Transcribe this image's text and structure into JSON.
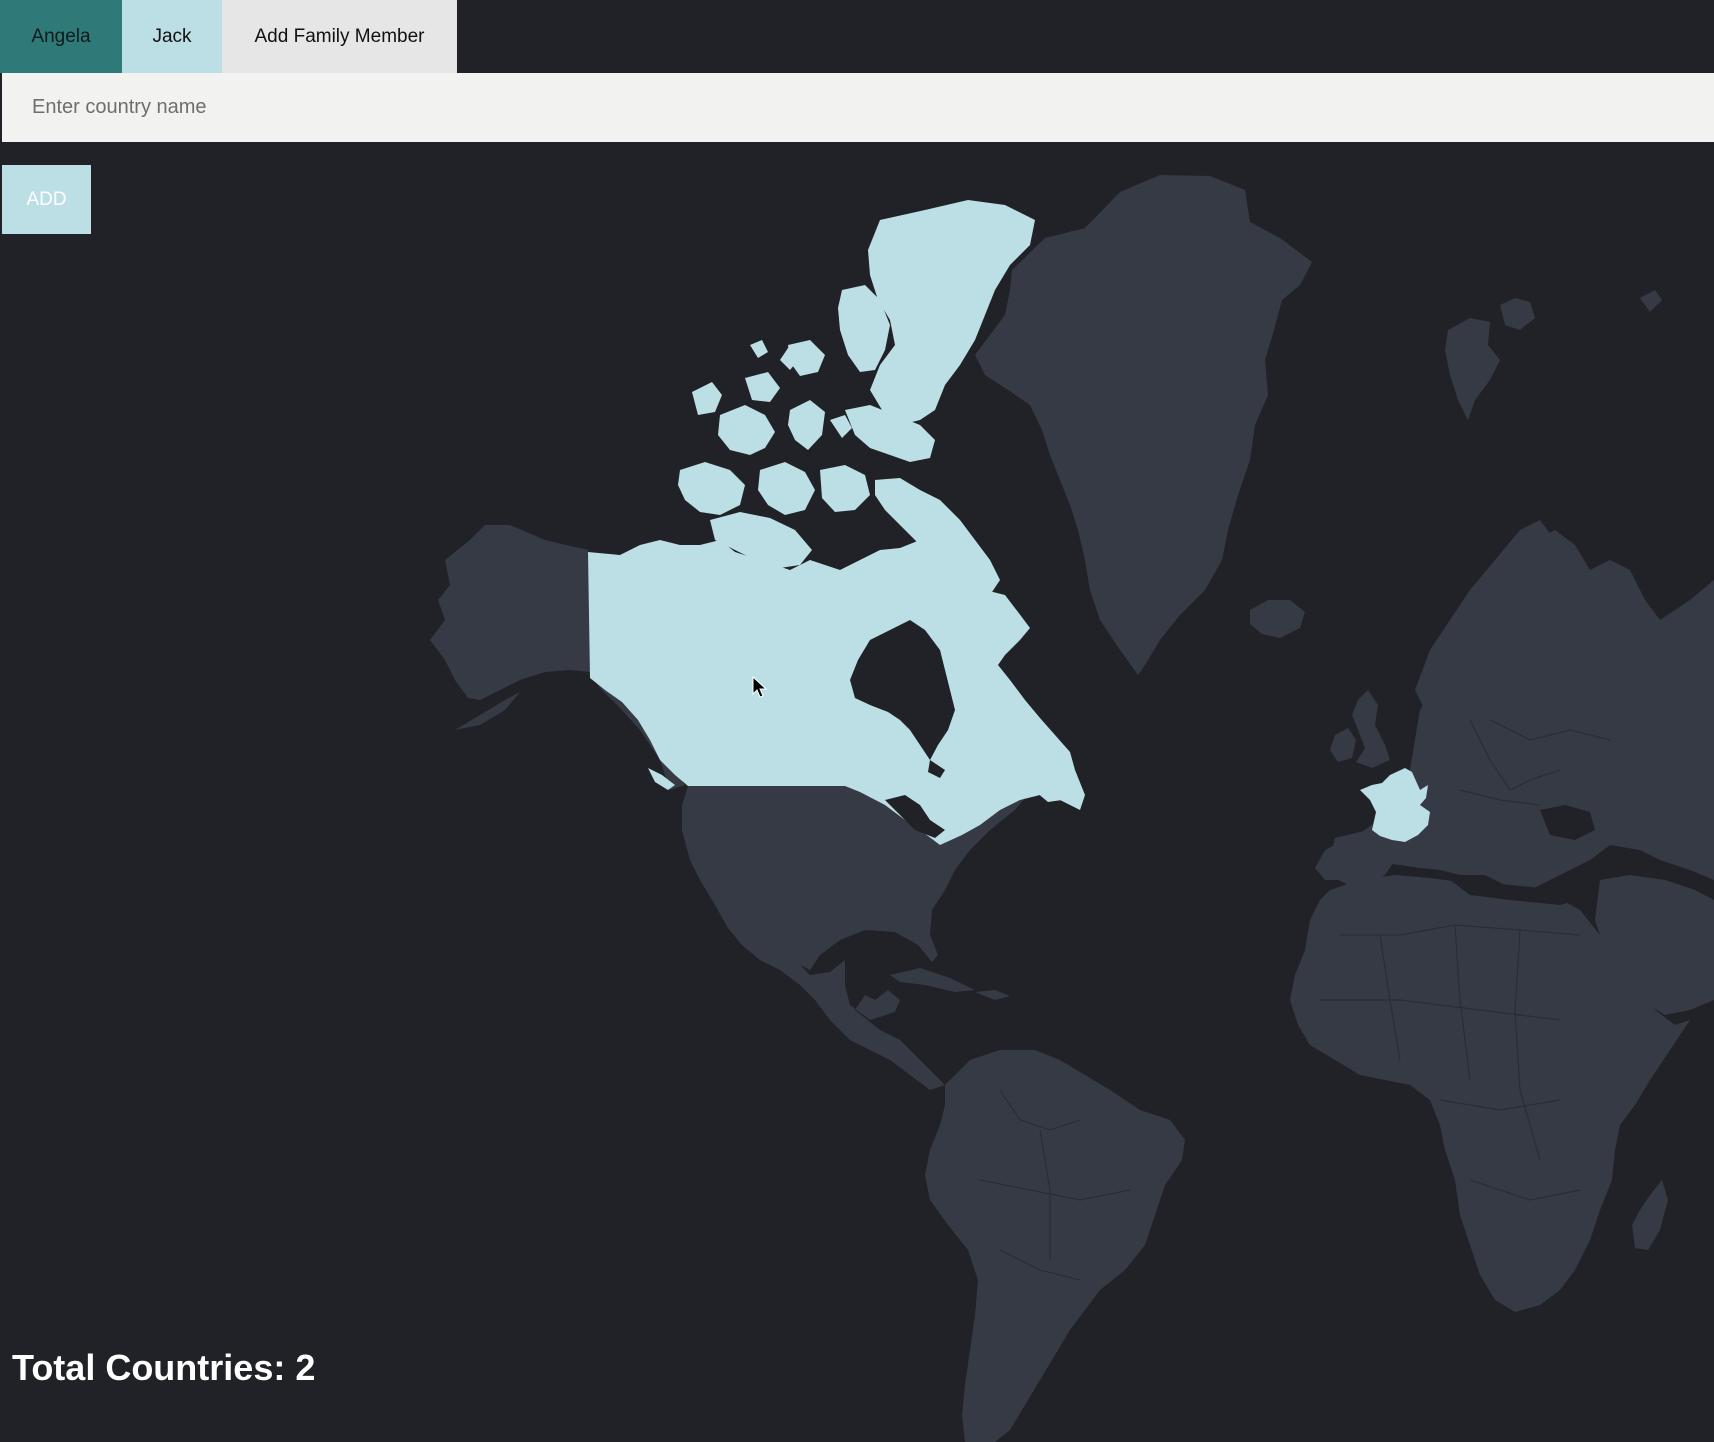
{
  "tabs": {
    "angela": "Angela",
    "jack": "Jack",
    "add_member": "Add Family Member"
  },
  "search": {
    "placeholder": "Enter country name",
    "value": ""
  },
  "add_button": "ADD",
  "total": {
    "label": "Total Countries: 2"
  },
  "map": {
    "visited_countries": [
      "Canada",
      "France"
    ],
    "colors": {
      "background": "#202227",
      "land": "#363a44",
      "visited": "#bcdfe5",
      "active_tab": "#2f7a78"
    }
  }
}
